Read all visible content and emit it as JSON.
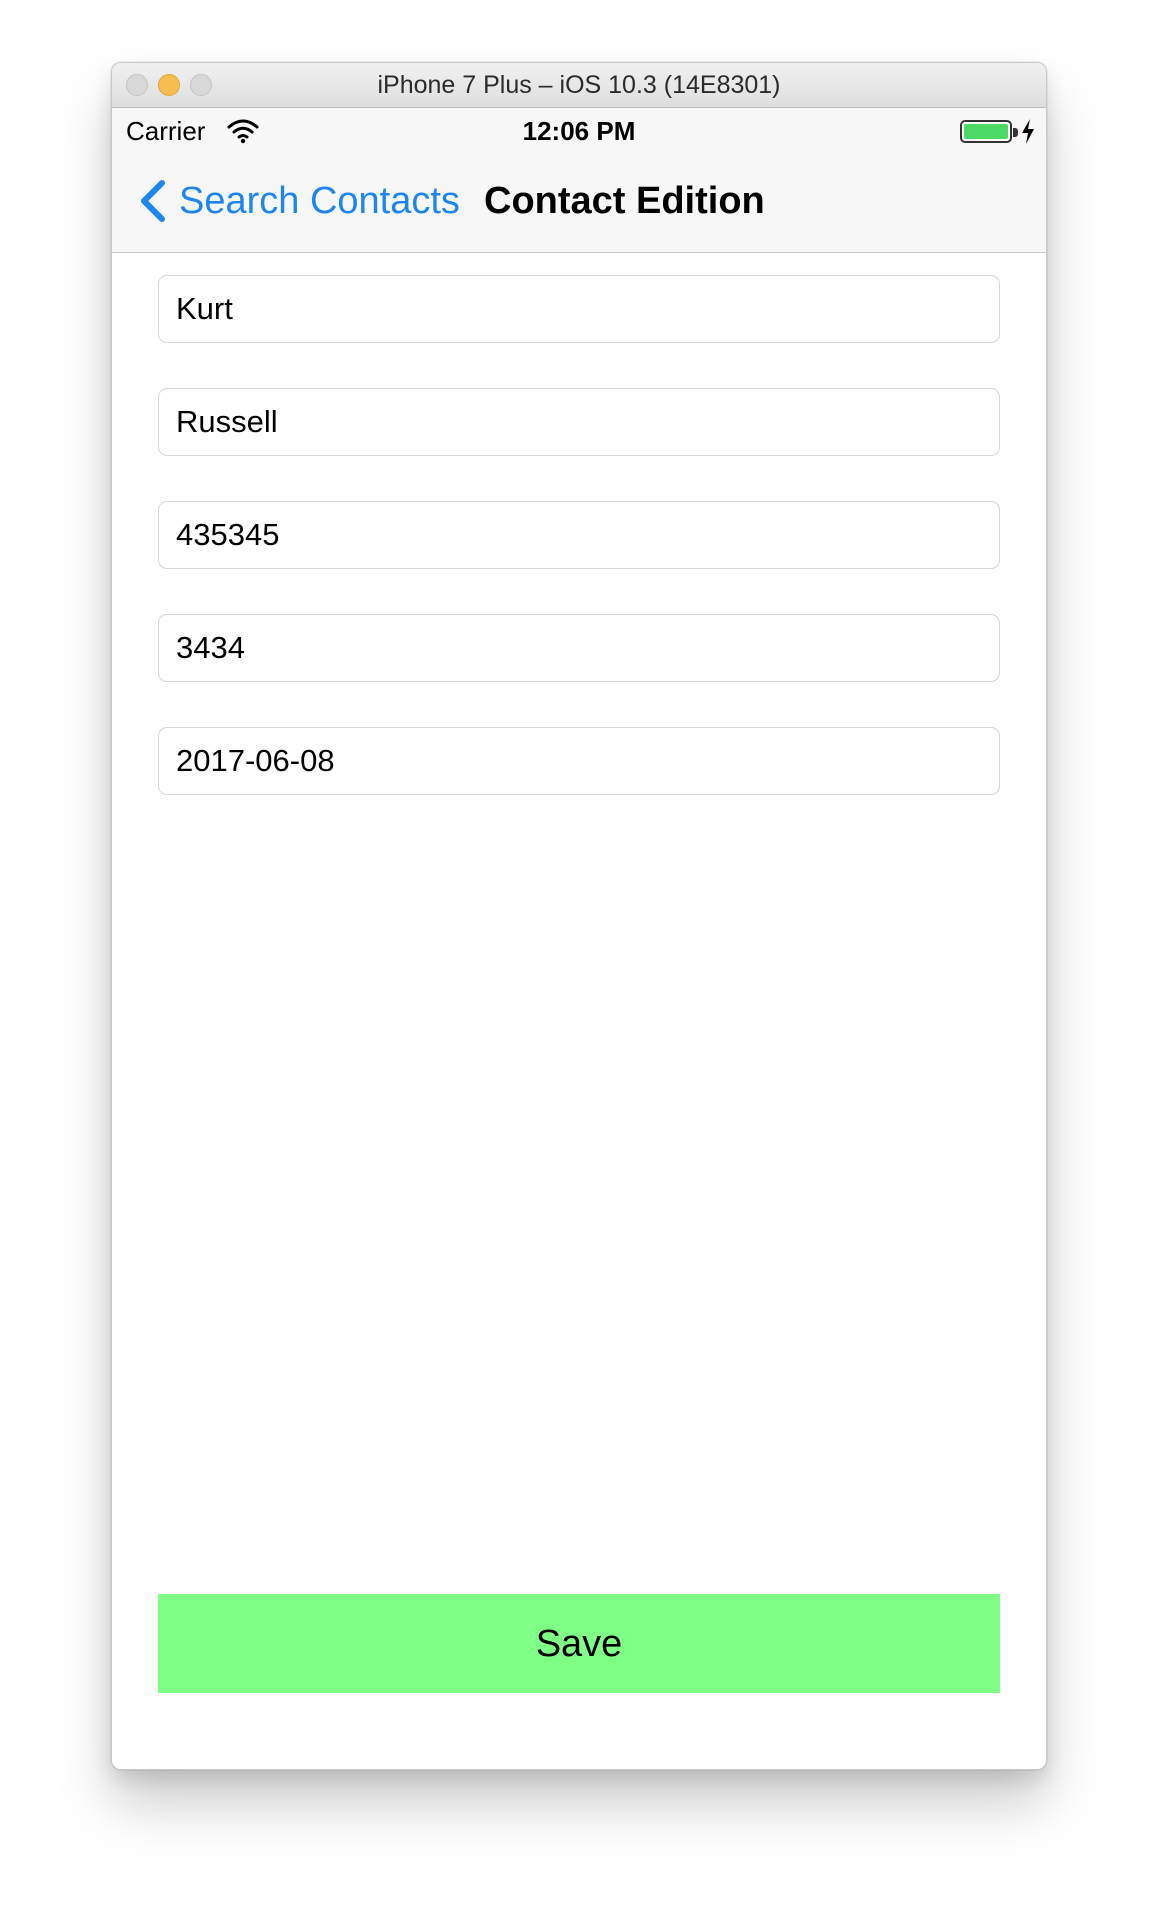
{
  "window": {
    "title": "iPhone 7 Plus – iOS 10.3 (14E8301)"
  },
  "status_bar": {
    "carrier": "Carrier",
    "time": "12:06 PM",
    "icons": {
      "wifi": "wifi-icon",
      "battery": "battery-icon",
      "charging": "charging-bolt-icon"
    }
  },
  "nav_bar": {
    "back_label": "Search Contacts",
    "title": "Contact Edition",
    "back_icon": "chevron-left-icon"
  },
  "form": {
    "fields": [
      {
        "value": "Kurt"
      },
      {
        "value": "Russell"
      },
      {
        "value": "435345"
      },
      {
        "value": "3434"
      },
      {
        "value": "2017-06-08"
      }
    ]
  },
  "actions": {
    "save_label": "Save"
  },
  "colors": {
    "accent": "#1e86ef",
    "save_button": "#80ff87",
    "battery": "#4cd964",
    "minimize": "#f6be4f"
  }
}
